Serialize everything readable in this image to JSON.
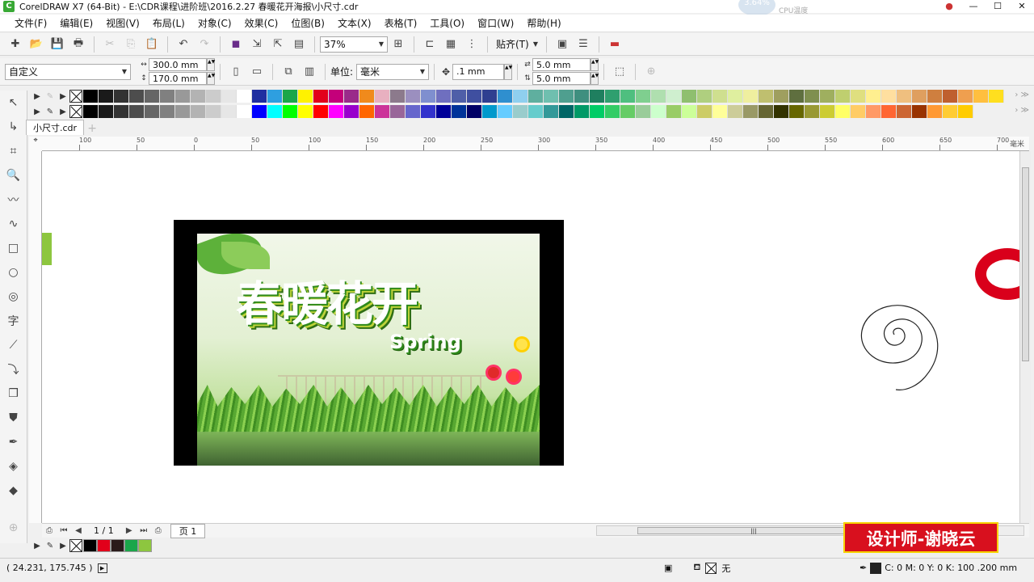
{
  "window": {
    "title": "CorelDRAW X7 (64-Bit) - E:\\CDR课程\\进阶班\\2016.2.27    春暖花开海报\\小尺寸.cdr",
    "cpu_value": "3.64%",
    "cpu_label": "CPU温度"
  },
  "menu": [
    "文件(F)",
    "编辑(E)",
    "视图(V)",
    "布局(L)",
    "对象(C)",
    "效果(C)",
    "位图(B)",
    "文本(X)",
    "表格(T)",
    "工具(O)",
    "窗口(W)",
    "帮助(H)"
  ],
  "toolbar": {
    "zoom": "37%",
    "snap_label": "贴齐(T)"
  },
  "property_bar": {
    "page_preset": "自定义",
    "width": "300.0 mm",
    "height": "170.0 mm",
    "units_label": "单位:",
    "units_value": "毫米",
    "nudge": ".1 mm",
    "dup_x": "5.0 mm",
    "dup_y": "5.0 mm"
  },
  "palette_colors_row1": [
    "#000000",
    "#1a1a1a",
    "#333333",
    "#4d4d4d",
    "#666666",
    "#808080",
    "#999999",
    "#b3b3b3",
    "#cccccc",
    "#e6e6e6",
    "#ffffff",
    "#1f2ea0",
    "#2e9fe0",
    "#1aa64a",
    "#fff200",
    "#e2001a",
    "#c4007a",
    "#9a2a8a",
    "#f08a1c",
    "#e8b0c0",
    "#8c7a8c",
    "#9b8fbf",
    "#7f8fcf",
    "#6f6fbf",
    "#4f5fa8",
    "#3f4fa0",
    "#2f3f90",
    "#2f8fcf",
    "#8fcfef",
    "#5faf9f",
    "#6fbfaf",
    "#4f9f8f",
    "#3f8f7f",
    "#1f7f5f",
    "#2f9f6f",
    "#4fbf7f",
    "#7fcf8f",
    "#afdfaf",
    "#cfefcf",
    "#8fbf6f",
    "#afcf7f",
    "#cfdf8f",
    "#dfef9f",
    "#efef9f",
    "#bfbf6f",
    "#9f9f5f",
    "#5f6f3f",
    "#7f8f4f",
    "#9faf5f",
    "#bfcf6f",
    "#dfdf7f",
    "#ffef8f",
    "#ffdf9f",
    "#efbf7f",
    "#df9f5f",
    "#cf7f3f",
    "#bf5f2f",
    "#ef9f4f",
    "#ffbf3f",
    "#ffdf1f"
  ],
  "palette_colors_row2": [
    "#000000",
    "#1a1a1a",
    "#333333",
    "#4d4d4d",
    "#666666",
    "#808080",
    "#999999",
    "#b3b3b3",
    "#cccccc",
    "#e6e6e6",
    "#ffffff",
    "#0000ff",
    "#00ffff",
    "#00ff00",
    "#ffff00",
    "#ff0000",
    "#ff00ff",
    "#9900cc",
    "#ff6600",
    "#cc3399",
    "#996699",
    "#6666cc",
    "#3333cc",
    "#000099",
    "#003399",
    "#000066",
    "#0099cc",
    "#66ccff",
    "#99cccc",
    "#66cccc",
    "#339999",
    "#006666",
    "#009966",
    "#00cc66",
    "#33cc66",
    "#66cc66",
    "#99cc99",
    "#ccffcc",
    "#99cc66",
    "#ccff99",
    "#cccc66",
    "#ffff99",
    "#cccc99",
    "#999966",
    "#666633",
    "#333300",
    "#666600",
    "#999933",
    "#cccc33",
    "#ffff66",
    "#ffcc66",
    "#ff9966",
    "#ff6633",
    "#cc6633",
    "#993300",
    "#ff9933",
    "#ffcc33",
    "#ffcc00"
  ],
  "document_tab": "小尺寸.cdr",
  "ruler_ticks": [
    "100",
    "50",
    "0",
    "50",
    "100",
    "150",
    "200",
    "250",
    "300",
    "350",
    "400",
    "450",
    "500",
    "550",
    "600",
    "650",
    "700"
  ],
  "ruler_unit": "毫米",
  "poster": {
    "title": "春暖花开",
    "subtitle": "Spring"
  },
  "page_nav": {
    "count": "1 / 1",
    "page_tab": "页 1"
  },
  "document_palette": [
    "#000000",
    "#e2001a",
    "#2a1a1a",
    "#1aa64a",
    "#8dc63f"
  ],
  "status": {
    "coords": "( 24.231, 175.745 )",
    "fill_label": "无",
    "outline_info": "C: 0 M: 0 Y: 0 K: 100  .200 mm",
    "outline_color": "#222222"
  },
  "watermark": "设计师-谢晓云"
}
